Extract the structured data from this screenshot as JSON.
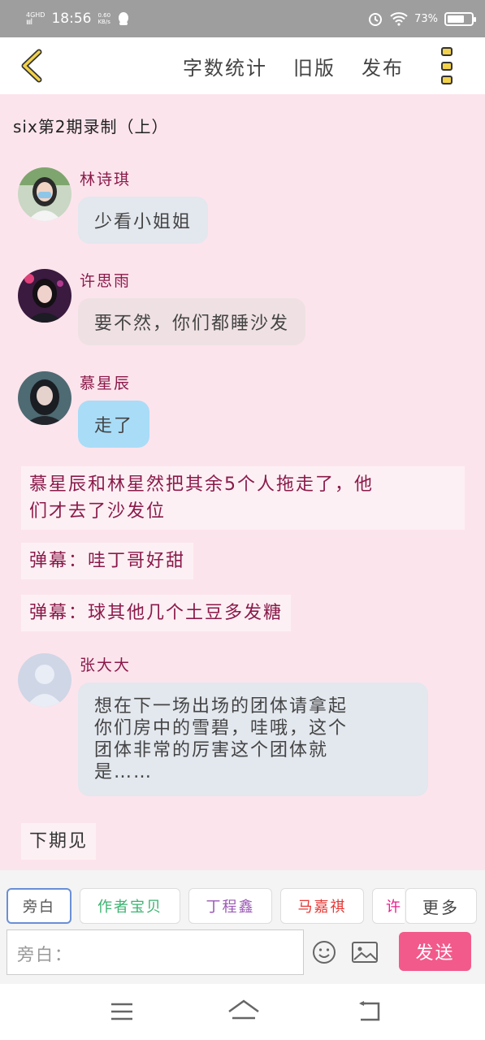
{
  "status_bar": {
    "network_top": "4GHD",
    "network_bottom": "ıııl",
    "time": "18:56",
    "speed_value": "0.60",
    "speed_unit": "KB/s",
    "battery": "73%",
    "battery_level": 0.73
  },
  "top_nav": {
    "word_count_label": "字数统计",
    "old_version_label": "旧版",
    "publish_label": "发布"
  },
  "chat": {
    "title": "six第2期录制（上）",
    "messages": [
      {
        "speaker": "林诗琪",
        "text": "少看小姐姐",
        "bubble_color": "#e3e7ee"
      },
      {
        "speaker": "许思雨",
        "text": "要不然，你们都睡沙发",
        "bubble_color": "#efe1e3"
      },
      {
        "speaker": "慕星辰",
        "text": "走了",
        "bubble_color": "#a9dcf7"
      }
    ],
    "narrations": [
      {
        "line1": "慕星辰和林星然把其余5个人拖走了，他",
        "line2": "们才去了沙发位"
      },
      {
        "line1": "弹幕：哇丁哥好甜"
      },
      {
        "line1": "弹幕：球其他几个土豆多发糖"
      }
    ],
    "last_message": {
      "speaker": "张大大",
      "lines": [
        "想在下一场出场的团体请拿起",
        "你们房中的雪碧，哇哦，这个",
        "团体非常的厉害这个团体就",
        "是……"
      ],
      "bubble_color": "#e3e7ee"
    },
    "final_narration": "下期见"
  },
  "role_tabs": [
    {
      "label": "旁白",
      "color": "#555555",
      "selected": true
    },
    {
      "label": "作者宝贝",
      "color": "#3cb371"
    },
    {
      "label": "丁程鑫",
      "color": "#9b59b6"
    },
    {
      "label": "马嘉祺",
      "color": "#e53935"
    },
    {
      "label": "许",
      "color": "#e91e8c"
    }
  ],
  "more_label": "更多",
  "input": {
    "placeholder": "旁白："
  },
  "send_label": "发送",
  "colors": {
    "accent": "#f25a8c",
    "background": "#fce4ec",
    "name": "#8a1a4a"
  }
}
